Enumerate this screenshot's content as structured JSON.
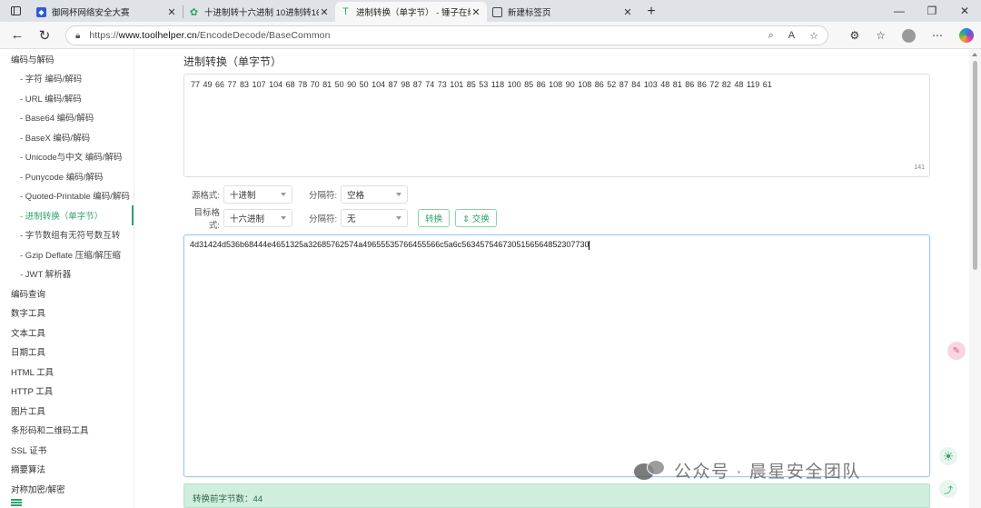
{
  "browser": {
    "tabs": [
      {
        "title": "御网杯网络安全大赛",
        "favicon": "shield-icon",
        "active": false
      },
      {
        "title": "十进制转十六进制 10进制转16进",
        "favicon": "gear-green-icon",
        "active": false
      },
      {
        "title": "进制转换（单字节） - 锤子在线工",
        "favicon": "hammer-icon",
        "active": true
      },
      {
        "title": "新建标签页",
        "favicon": "newtab-icon",
        "active": false
      }
    ],
    "url_prefix": "https://",
    "url_host": "www.toolhelper.cn",
    "url_path": "/EncodeDecode/BaseCommon"
  },
  "sidebar": {
    "items": [
      {
        "label": "编码与解码",
        "level": "top",
        "active": false
      },
      {
        "label": "- 字符  编码/解码",
        "level": "sub",
        "active": false
      },
      {
        "label": "- URL  编码/解码",
        "level": "sub",
        "active": false
      },
      {
        "label": "- Base64  编码/解码",
        "level": "sub",
        "active": false
      },
      {
        "label": "- BaseX  编码/解码",
        "level": "sub",
        "active": false
      },
      {
        "label": "- Unicode与中文  编码/解码",
        "level": "sub",
        "active": false
      },
      {
        "label": "- Punycode  编码/解码",
        "level": "sub",
        "active": false
      },
      {
        "label": "- Quoted-Printable  编码/解码",
        "level": "sub",
        "active": false
      },
      {
        "label": "- 进制转换（单字节）",
        "level": "sub",
        "active": true
      },
      {
        "label": "- 字节数组有无符号数互转",
        "level": "sub",
        "active": false
      },
      {
        "label": "- Gzip Deflate 压缩/解压缩",
        "level": "sub",
        "active": false
      },
      {
        "label": "- JWT 解析器",
        "level": "sub",
        "active": false
      },
      {
        "label": "编码查询",
        "level": "top",
        "active": false
      },
      {
        "label": "数字工具",
        "level": "top",
        "active": false
      },
      {
        "label": "文本工具",
        "level": "top",
        "active": false
      },
      {
        "label": "日期工具",
        "level": "top",
        "active": false
      },
      {
        "label": "HTML 工具",
        "level": "top",
        "active": false
      },
      {
        "label": "HTTP 工具",
        "level": "top",
        "active": false
      },
      {
        "label": "图片工具",
        "level": "top",
        "active": false
      },
      {
        "label": "条形码和二维码工具",
        "level": "top",
        "active": false
      },
      {
        "label": "SSL 证书",
        "level": "top",
        "active": false
      },
      {
        "label": "摘要算法",
        "level": "top",
        "active": false
      },
      {
        "label": "对称加密/解密",
        "level": "top",
        "active": false
      }
    ]
  },
  "main": {
    "title": "进制转换（单字节）",
    "input_text": "77 49 66 77 83 107 104 68 78 70 81 50 90 50 104 87 98 87 74 73 101 85 53 118 100 85 86 108 90 108 86 52 87 84 103 48 81 86 86 72 82 48 119 61",
    "input_count": "141",
    "source_format_label": "源格式:",
    "source_format_value": "十进制",
    "source_sep_label": "分隔符:",
    "source_sep_value": "空格",
    "target_format_label": "目标格式:",
    "target_format_value": "十六进制",
    "target_sep_label": "分隔符:",
    "target_sep_value": "无",
    "convert_button": "转换",
    "swap_button": "⇕ 交换",
    "output_text": "4d31424d536b68444e4651325a32685762574a49655535766455566c5a6c5634575467305156564852307730",
    "result_text": "转换前字节数：44"
  },
  "watermark": {
    "text": "公众号 · 晨星安全团队"
  },
  "colors": {
    "accent": "#2ea46b",
    "result_bg": "#cfeedd"
  }
}
